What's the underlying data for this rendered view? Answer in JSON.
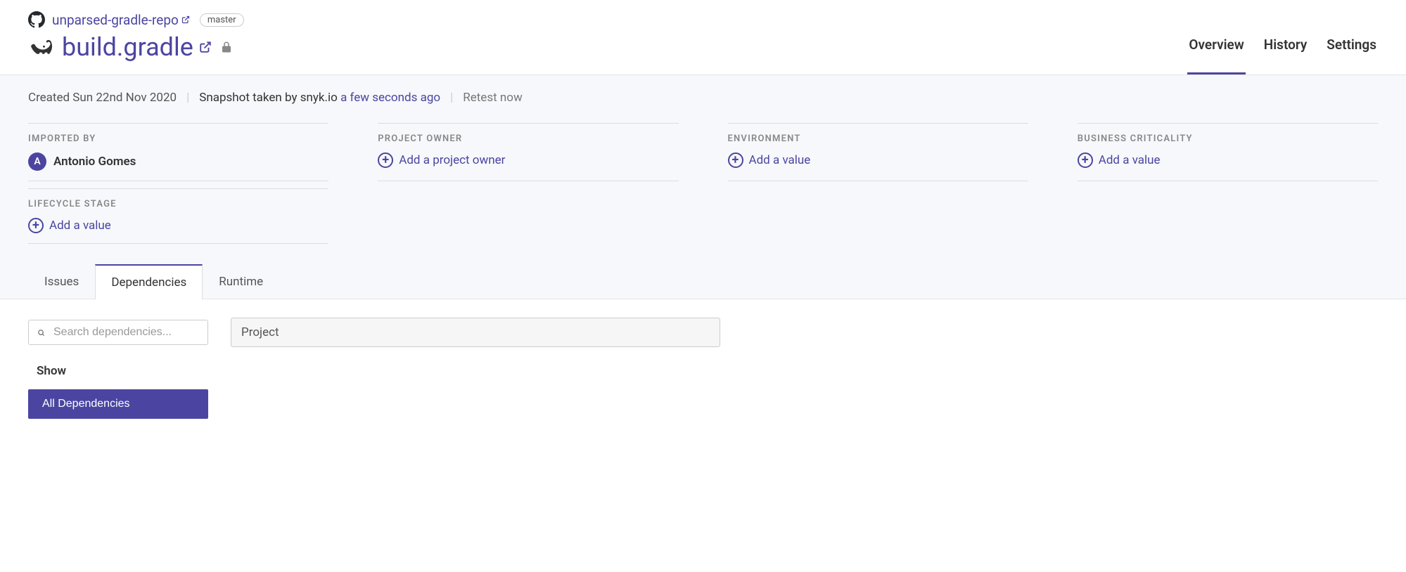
{
  "header": {
    "repo_name": "unparsed-gradle-repo",
    "branch": "master",
    "file_name": "build.gradle"
  },
  "top_tabs": [
    {
      "label": "Overview",
      "active": true
    },
    {
      "label": "History",
      "active": false
    },
    {
      "label": "Settings",
      "active": false
    }
  ],
  "meta_row": {
    "created": "Created Sun 22nd Nov 2020",
    "snapshot_prefix": "Snapshot taken by snyk.io ",
    "snapshot_link": "a few seconds ago",
    "retest": "Retest now"
  },
  "meta_cards": {
    "imported_by": {
      "label": "Imported By",
      "user_initial": "A",
      "user_name": "Antonio Gomes"
    },
    "project_owner": {
      "label": "Project Owner",
      "add_text": "Add a project owner"
    },
    "environment": {
      "label": "Environment",
      "add_text": "Add a value"
    },
    "business_criticality": {
      "label": "Business Criticality",
      "add_text": "Add a value"
    },
    "lifecycle_stage": {
      "label": "Lifecycle Stage",
      "add_text": "Add a value"
    }
  },
  "sub_tabs": [
    {
      "label": "Issues",
      "active": false
    },
    {
      "label": "Dependencies",
      "active": true
    },
    {
      "label": "Runtime",
      "active": false
    }
  ],
  "filters": {
    "search_placeholder": "Search dependencies...",
    "project_select": "Project",
    "show_label": "Show",
    "all_deps": "All Dependencies"
  }
}
